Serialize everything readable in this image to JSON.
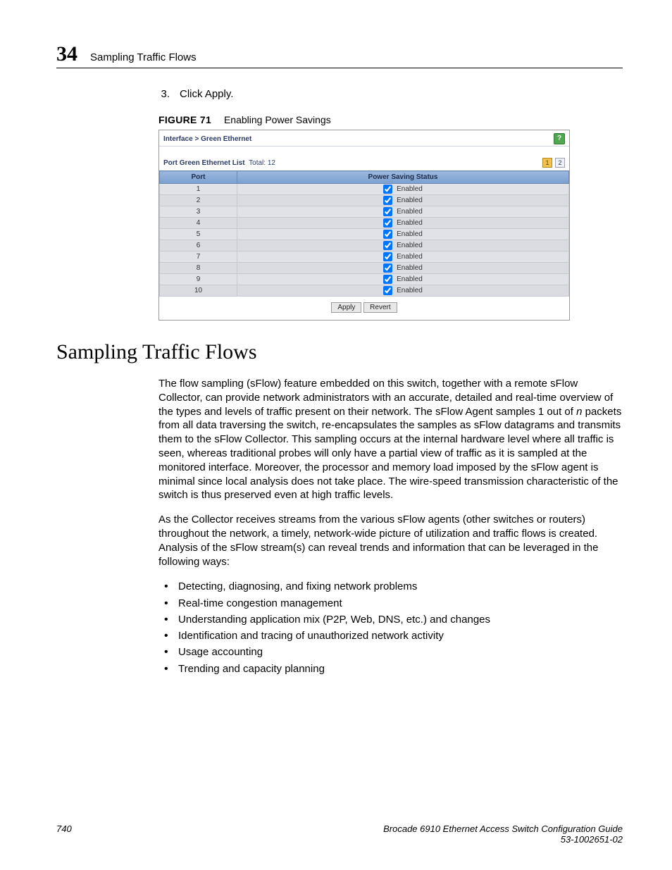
{
  "header": {
    "chapter_number": "34",
    "chapter_title": "Sampling Traffic Flows"
  },
  "step": {
    "number": "3.",
    "text": "Click Apply."
  },
  "figure": {
    "label": "FIGURE 71",
    "caption": "Enabling Power Savings",
    "breadcrumb": "Interface > Green Ethernet",
    "list_label": "Port Green Ethernet List",
    "list_total_label": "Total:",
    "list_total_value": "12",
    "page_current": "1",
    "page_other": "2",
    "col_port": "Port",
    "col_status": "Power Saving Status",
    "status_text": "Enabled",
    "rows": [
      {
        "port": "1"
      },
      {
        "port": "2"
      },
      {
        "port": "3"
      },
      {
        "port": "4"
      },
      {
        "port": "5"
      },
      {
        "port": "6"
      },
      {
        "port": "7"
      },
      {
        "port": "8"
      },
      {
        "port": "9"
      },
      {
        "port": "10"
      }
    ],
    "apply": "Apply",
    "revert": "Revert",
    "help": "?"
  },
  "section": {
    "heading": "Sampling Traffic Flows",
    "para1a": "The flow sampling (sFlow) feature embedded on this switch, together with a remote sFlow Collector, can provide network administrators with an accurate, detailed and real-time overview of the types and levels of traffic present on their network. The sFlow Agent samples 1 out of ",
    "para1_n": "n",
    "para1b": " packets from all data traversing the switch, re-encapsulates the samples as sFlow datagrams and transmits them to the sFlow Collector. This sampling occurs at the internal hardware level where all traffic is seen, whereas traditional probes will only have a partial view of traffic as it is sampled at the monitored interface. Moreover, the processor and memory load imposed by the sFlow agent is minimal since local analysis does not take place. The wire-speed transmission characteristic of the switch is thus preserved even at high traffic levels.",
    "para2": "As the Collector receives streams from the various sFlow agents (other switches or routers) throughout the network, a timely, network-wide picture of utilization and traffic flows is created. Analysis of the sFlow stream(s) can reveal trends and information that can be leveraged in the following ways:",
    "bullets": [
      "Detecting, diagnosing, and fixing network problems",
      "Real-time congestion management",
      "Understanding application mix (P2P, Web, DNS, etc.) and changes",
      "Identification and tracing of unauthorized network activity",
      "Usage accounting",
      "Trending and capacity planning"
    ]
  },
  "footer": {
    "page_number": "740",
    "doc_title": "Brocade 6910 Ethernet Access Switch Configuration Guide",
    "doc_id": "53-1002651-02"
  }
}
